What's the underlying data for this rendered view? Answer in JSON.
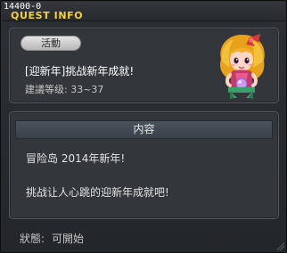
{
  "window": {
    "quest_id": "14400-0",
    "title": "QUEST INFO"
  },
  "quest": {
    "badge": "活動",
    "name": "[迎新年]挑战新年成就!",
    "level": "建議等级: 33~37",
    "npc": "npc-portrait"
  },
  "content": {
    "header": "内容",
    "lines": [
      "冒险岛 2014年新年!",
      "挑战让人心跳的迎新年成就吧!"
    ]
  },
  "status": {
    "label": "狀態:",
    "value": "可開始"
  },
  "colors": {
    "title": "#f2d23a",
    "panel": "#33363a",
    "header": "#444b54"
  }
}
